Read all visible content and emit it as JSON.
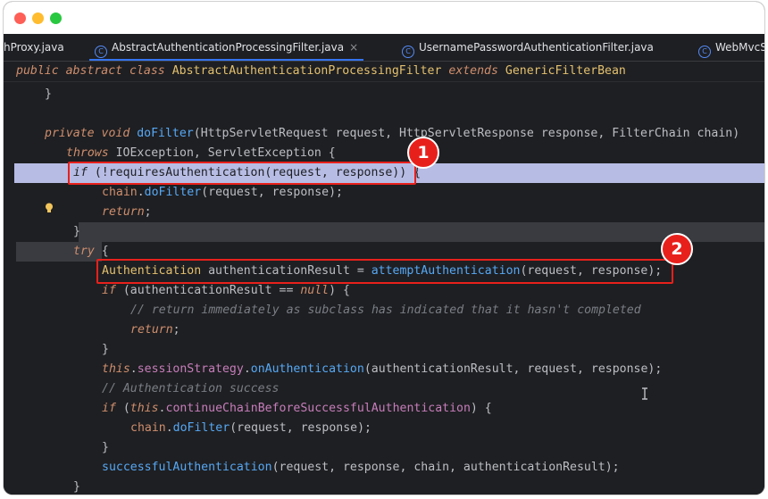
{
  "tabs": [
    {
      "label": "hProxy.java",
      "icon": "class-icon",
      "active": false
    },
    {
      "label": "AbstractAuthenticationProcessingFilter.java",
      "icon": "class-icon",
      "active": true
    },
    {
      "label": "UsernamePasswordAuthenticationFilter.java",
      "icon": "class-icon",
      "active": false
    },
    {
      "label": "WebMvcSe",
      "icon": "class-icon",
      "active": false
    }
  ],
  "tab_close_glyph": "×",
  "class_icon_glyph": "C",
  "breadcrumb": {
    "kw1": "public abstract class",
    "class_name": "AbstractAuthenticationProcessingFilter",
    "kw2": "extends",
    "parent": "GenericFilterBean"
  },
  "code": {
    "l1": "}",
    "l3_kw": "private void",
    "l3_fn": "doFilter",
    "l3_rest_a": "(HttpServletRequest ",
    "l3_p1": "request",
    "l3_rest_b": ", HttpServletResponse ",
    "l3_p2": "response",
    "l3_rest_c": ", FilterChain ",
    "l3_p3": "chain",
    "l3_rest_d": ")",
    "l4_kw": "throws",
    "l4_rest": " IOException, ServletException {",
    "l5_kw": "if",
    "l5_a": " (!",
    "l5_fn": "requiresAuthentication",
    "l5_b": "(request, response)) {",
    "l6_obj": "chain",
    "l6_fn": "doFilter",
    "l6_b": "(request, response);",
    "l7_kw": "return",
    "l7_b": ";",
    "l8": "}",
    "l9_kw": "try",
    "l9_b": " {",
    "l10_type": "Authentication",
    "l10_var": " authenticationResult = ",
    "l10_fn": "attemptAuthentication",
    "l10_b": "(request, response);",
    "l11_kw": "if",
    "l11_b": " (authenticationResult == ",
    "l11_null": "null",
    "l11_c": ") {",
    "l12": "// return immediately as subclass has indicated that it hasn't completed",
    "l13_kw": "return",
    "l13_b": ";",
    "l14": "}",
    "l15_this": "this",
    "l15_fld": "sessionStrategy",
    "l15_fn": "onAuthentication",
    "l15_b": "(authenticationResult, request, response);",
    "l16": "// Authentication success",
    "l17_kw": "if",
    "l17_a": " (",
    "l17_this": "this",
    "l17_fld": "continueChainBeforeSuccessfulAuthentication",
    "l17_b": ") {",
    "l18_obj": "chain",
    "l18_fn": "doFilter",
    "l18_b": "(request, response);",
    "l19": "}",
    "l20_fn": "successfulAuthentication",
    "l20_b": "(request, response, chain, authenticationResult);",
    "l21": "}"
  },
  "annotations": [
    {
      "label": "1"
    },
    {
      "label": "2"
    }
  ],
  "colors": {
    "annotation_red": "#e8201c",
    "active_tab_underline": "#3574f0",
    "current_line_highlight": "#c8cdf9"
  }
}
